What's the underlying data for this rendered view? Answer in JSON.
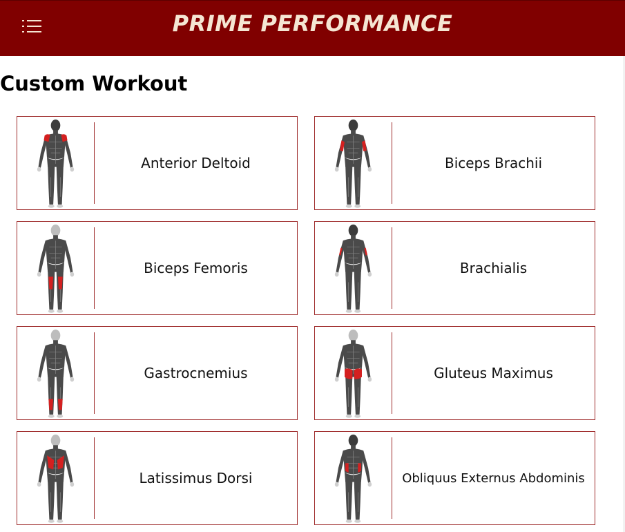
{
  "header": {
    "brand": "PRIME PERFORMANCE",
    "menu_icon": "menu-icon",
    "background_color": "#800000",
    "text_color": "#f5e6d3"
  },
  "page": {
    "title": "Custom Workout"
  },
  "muscles": [
    {
      "name": "Anterior Deltoid",
      "view": "front",
      "highlight": "shoulders"
    },
    {
      "name": "Biceps Brachii",
      "view": "front",
      "highlight": "upper-arms"
    },
    {
      "name": "Biceps Femoris",
      "view": "back",
      "highlight": "hamstrings"
    },
    {
      "name": "Brachialis",
      "view": "front",
      "highlight": "upper-arms-outer"
    },
    {
      "name": "Gastrocnemius",
      "view": "back",
      "highlight": "calves"
    },
    {
      "name": "Gluteus Maximus",
      "view": "back",
      "highlight": "glutes"
    },
    {
      "name": "Latissimus Dorsi",
      "view": "back",
      "highlight": "lats"
    },
    {
      "name": "Obliquus Externus Abdominis",
      "view": "front",
      "highlight": "obliques"
    }
  ],
  "colors": {
    "card_border": "#9e2a2a",
    "muscle_highlight": "#d42020",
    "body_fill": "#4a4a4a"
  }
}
